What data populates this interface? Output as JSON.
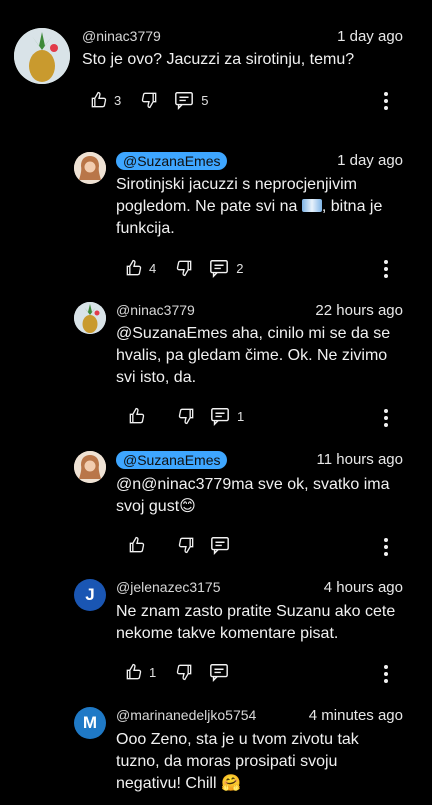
{
  "comments": [
    {
      "author": "@ninac3779",
      "time": "1 day ago",
      "text": "Sto je ovo? Jacuzzi za sirotinju, temu?",
      "likes": "3",
      "replies": "5"
    },
    {
      "author": "@SuzanaEmes",
      "time": "1 day ago",
      "text_a": "Sirotinjski jacuzzi s neprocjenjivim pogledom. Ne pate svi na ",
      "text_b": ", bitna je funkcija.",
      "likes": "4",
      "replies": "2"
    },
    {
      "author": "@ninac3779",
      "time": "22 hours ago",
      "text": "@SuzanaEmes aha, cinilo mi se da se hvalis, pa gledam čime. Ok. Ne zivimo svi isto, da.",
      "likes": "",
      "replies": "1"
    },
    {
      "author": "@SuzanaEmes",
      "time": "11 hours ago",
      "text": "@n@ninac3779ma sve ok, svatko ima svoj gust😊",
      "likes": "",
      "replies": ""
    },
    {
      "author": "@jelenazec3175",
      "avatar_letter": "J",
      "time": "4 hours ago",
      "text": "Ne znam zasto pratite Suzanu ako cete nekome takve komentare pisat.",
      "likes": "1",
      "replies": ""
    },
    {
      "author": "@marinanedeljko5754",
      "avatar_letter": "M",
      "time": "4 minutes ago",
      "text": "Ooo Zeno, sta je u tvom zivotu tak tuzno, da moras prosipati svoju negativu! Chill 🤗",
      "likes": "",
      "replies": ""
    }
  ],
  "colors": {
    "accent": "#3ea6ff",
    "avatar_blue": "#1a56b3",
    "avatar_teal": "#1f79c6"
  }
}
